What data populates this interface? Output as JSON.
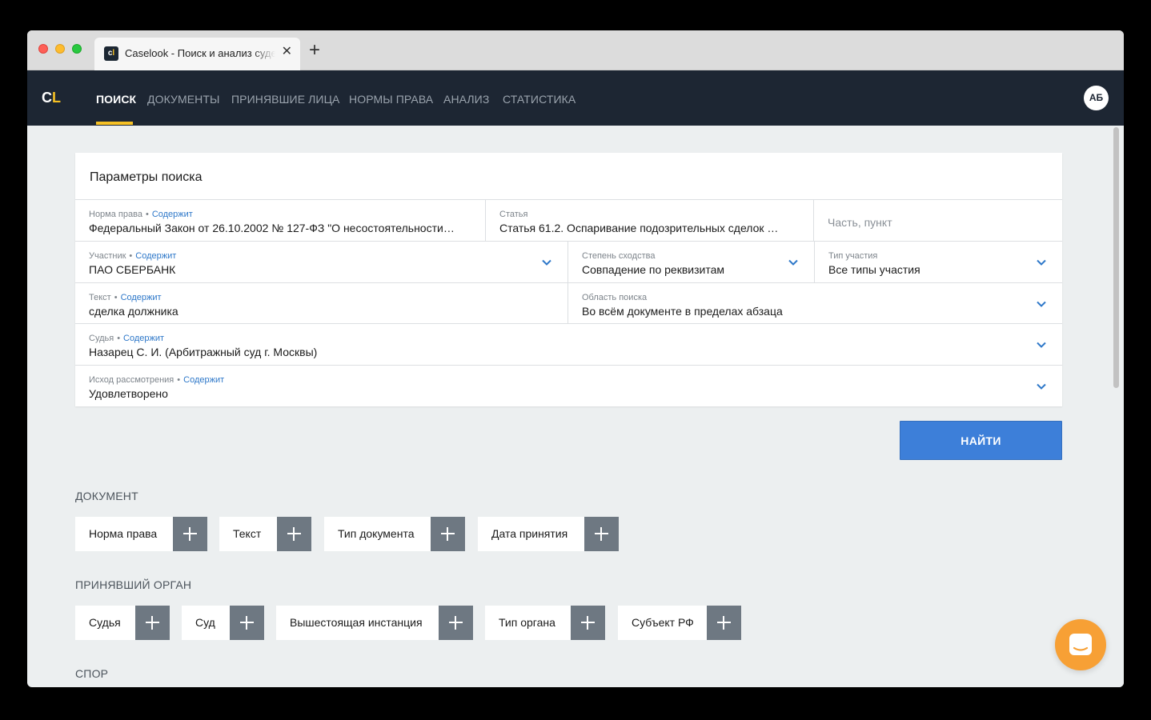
{
  "browser": {
    "tab_title": "Caselook - Поиск и анализ судебной практики",
    "favicon_text": "c",
    "favicon_accent": "l",
    "tab_close": "✕",
    "new_tab": "+"
  },
  "nav": {
    "logo_c": "C",
    "logo_l": "L",
    "items": [
      "ПОИСК",
      "ДОКУМЕНТЫ",
      "ПРИНЯВШИЕ ЛИЦА",
      "НОРМЫ ПРАВА",
      "АНАЛИЗ",
      "СТАТИСТИКА"
    ],
    "active_index": 0,
    "avatar": "АБ"
  },
  "search": {
    "title": "Параметры поиска",
    "contains": "Содержит",
    "dot": "•",
    "fields": {
      "norm": {
        "label": "Норма права",
        "value": "Федеральный Закон от 26.10.2002 № 127-ФЗ \"О несостоятельности…"
      },
      "article": {
        "label": "Статья",
        "value": "Статья 61.2. Оспаривание подозрительных сделок …"
      },
      "part": {
        "placeholder": "Часть, пункт"
      },
      "participant": {
        "label": "Участник",
        "value": "ПАО СБЕРБАНК"
      },
      "similarity": {
        "label": "Степень сходства",
        "value": "Совпадение по реквизитам"
      },
      "participation_type": {
        "label": "Тип участия",
        "value": "Все типы участия"
      },
      "text": {
        "label": "Текст",
        "value": "сделка должника"
      },
      "search_area": {
        "label": "Область поиска",
        "value": "Во всём документе в пределах абзаца"
      },
      "judge": {
        "label": "Судья",
        "value": "Назарец С. И. (Арбитражный суд г. Москвы)"
      },
      "outcome": {
        "label": "Исход рассмотрения",
        "value": "Удовлетворено"
      }
    },
    "find_button": "НАЙТИ"
  },
  "sections": {
    "document": {
      "title": "ДОКУМЕНТ",
      "chips": [
        "Норма права",
        "Текст",
        "Тип документа",
        "Дата принятия"
      ]
    },
    "authority": {
      "title": "ПРИНЯВШИЙ ОРГАН",
      "chips": [
        "Судья",
        "Суд",
        "Вышестоящая инстанция",
        "Тип органа",
        "Субъект РФ"
      ]
    },
    "dispute": {
      "title": "СПОР"
    }
  },
  "colors": {
    "navbar": "#1d2633",
    "accent": "#f5c024",
    "link": "#2e78c9",
    "primary_button": "#3d7fd9",
    "chip_plus": "#6e7882",
    "chat": "#f7a035"
  }
}
